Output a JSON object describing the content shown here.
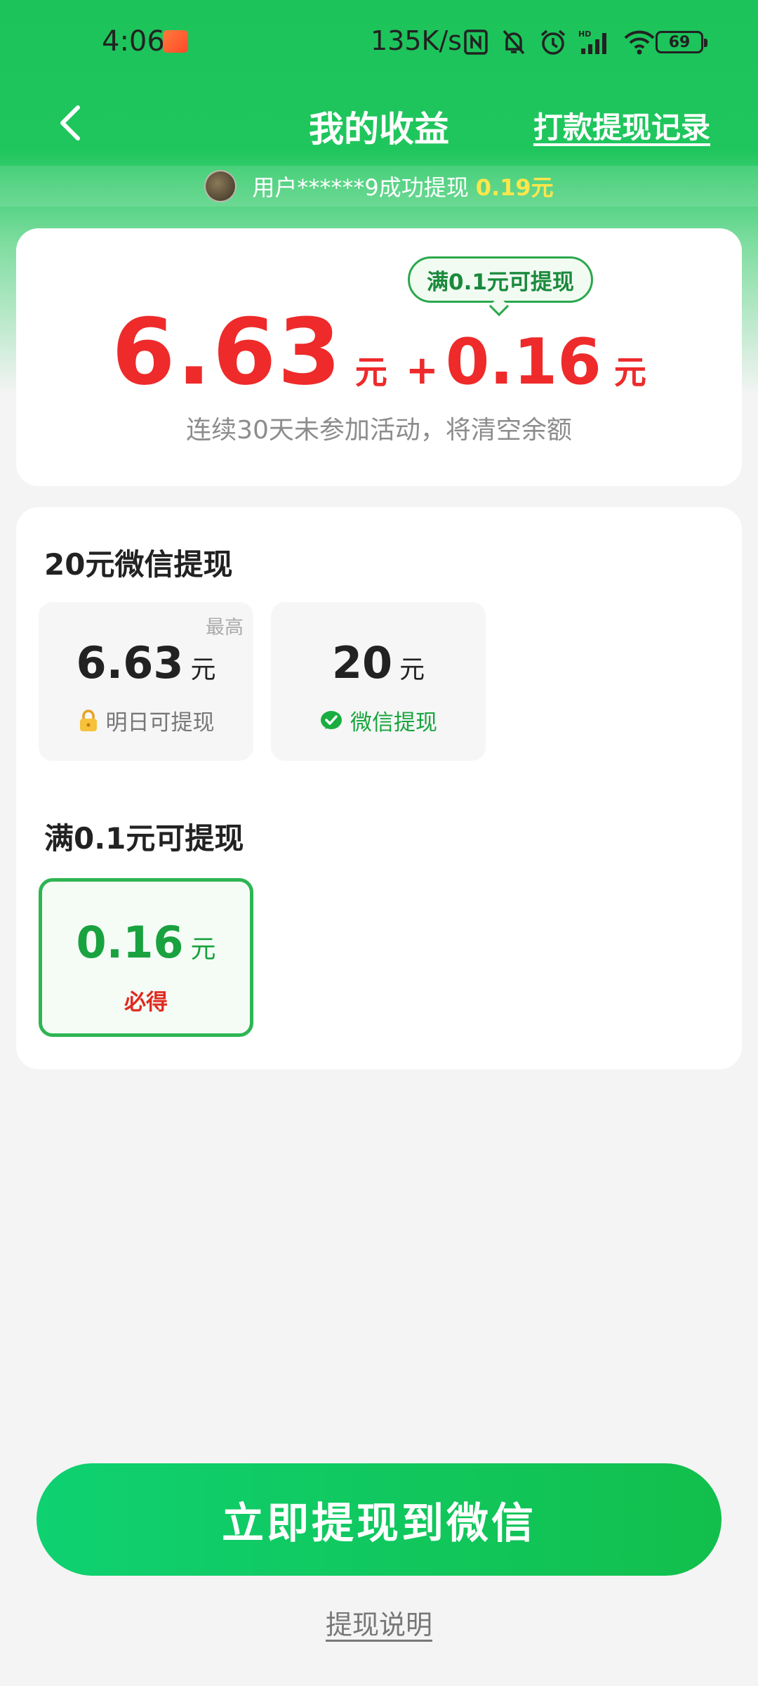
{
  "status_bar": {
    "time": "4:06",
    "network_speed": "135K/s",
    "battery": "69",
    "icons": [
      "nfc-icon",
      "mute-icon",
      "alarm-icon",
      "signal-icon",
      "wifi-icon",
      "battery-icon"
    ]
  },
  "header": {
    "title": "我的收益",
    "record_link": "打款提现记录"
  },
  "ticker": {
    "text": "用户******9成功提现",
    "amount": "0.19元"
  },
  "balance": {
    "tooltip": "满0.1元可提现",
    "main_amount": "6.63",
    "main_unit": "元",
    "plus": "+",
    "extra_amount": "0.16",
    "extra_unit": "元",
    "note": "连续30天未参加活动，将清空余额",
    "color": "#ee2a2a"
  },
  "wechat_section": {
    "title": "20元微信提现",
    "tiles": [
      {
        "tag": "最高",
        "amount": "6.63",
        "unit": "元",
        "sub": "明日可提现",
        "icon": "lock-icon"
      },
      {
        "amount": "20",
        "unit": "元",
        "sub": "微信提现",
        "icon": "wechat-check-icon"
      }
    ]
  },
  "min_section": {
    "title": "满0.1元可提现",
    "tiles": [
      {
        "amount": "0.16",
        "unit": "元",
        "sub": "必得",
        "selected": true
      }
    ]
  },
  "cta": {
    "label": "立即提现到微信",
    "color": "#12bf4c"
  },
  "help_link": "提现说明"
}
